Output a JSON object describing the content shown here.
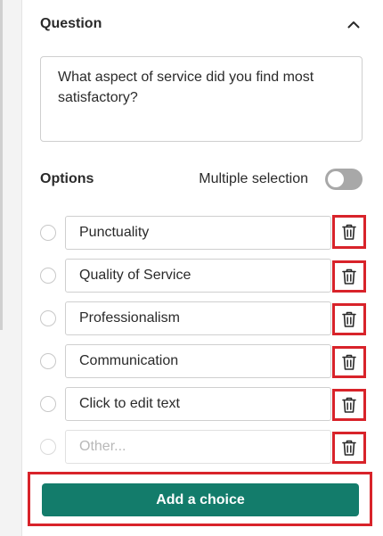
{
  "header": {
    "title": "Question"
  },
  "question": {
    "text": "What aspect of service did you find most satisfactory?"
  },
  "options_section": {
    "title": "Options",
    "multiple_selection_label": "Multiple selection",
    "multiple_selection_enabled": false
  },
  "options": [
    {
      "label": "Punctuality"
    },
    {
      "label": "Quality of Service"
    },
    {
      "label": "Professionalism"
    },
    {
      "label": "Communication"
    },
    {
      "label": "Click to edit text"
    }
  ],
  "other_option": {
    "placeholder": "Other..."
  },
  "add_choice": {
    "label": "Add a choice"
  },
  "colors": {
    "accent": "#137c6b",
    "highlight": "#d8232a",
    "toggle_off": "#a8a8a8"
  },
  "icons": {
    "collapse": "chevron-up-icon",
    "delete": "trash-icon"
  }
}
